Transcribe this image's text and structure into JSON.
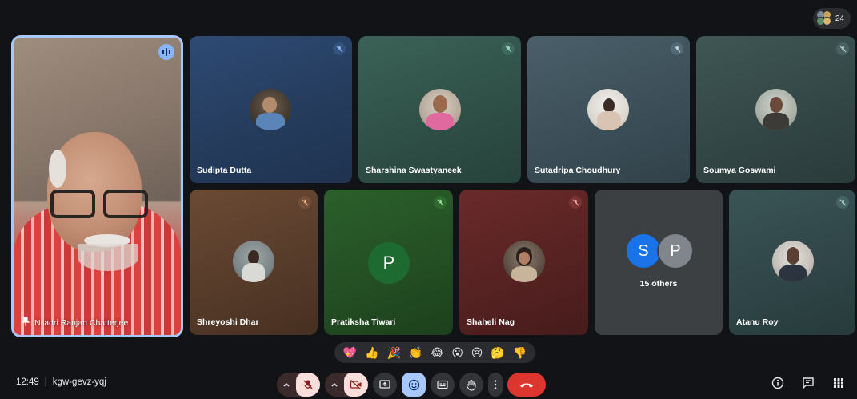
{
  "header": {
    "participant_count": "24"
  },
  "speaker": {
    "name": "Niladri Ranjan Chatterjee",
    "speaking": true
  },
  "tiles": [
    {
      "name": "Sudipta Dutta",
      "avatar": "photo",
      "muted": true
    },
    {
      "name": "Sharshina Swastyaneek",
      "avatar": "photo",
      "muted": true
    },
    {
      "name": "Sutadripa Choudhury",
      "avatar": "photo",
      "muted": true
    },
    {
      "name": "Soumya Goswami",
      "avatar": "photo",
      "muted": true
    },
    {
      "name": "Shreyoshi Dhar",
      "avatar": "photo",
      "muted": true
    },
    {
      "name": "Pratiksha Tiwari",
      "avatar": "letter",
      "letter": "P",
      "muted": true
    },
    {
      "name": "Shaheli Nag",
      "avatar": "photo",
      "muted": true
    },
    {
      "name": "Atanu Roy",
      "avatar": "photo",
      "muted": true
    }
  ],
  "others": {
    "letters": [
      "S",
      "P"
    ],
    "label": "15 others"
  },
  "reactions": [
    "💖",
    "👍",
    "🎉",
    "👏",
    "😂",
    "😮",
    "😢",
    "🤔",
    "👎"
  ],
  "meeting": {
    "time": "12:49",
    "separator": "|",
    "code": "kgw-gevz-yqj"
  },
  "colors": {
    "accent": "#a8c7fa",
    "leave": "#dc362e",
    "mic_off_bg": "#f9dedc",
    "green_avatar": "#1e6b32",
    "blue_avatar": "#1a73e8",
    "grey_avatar": "#80868b"
  }
}
